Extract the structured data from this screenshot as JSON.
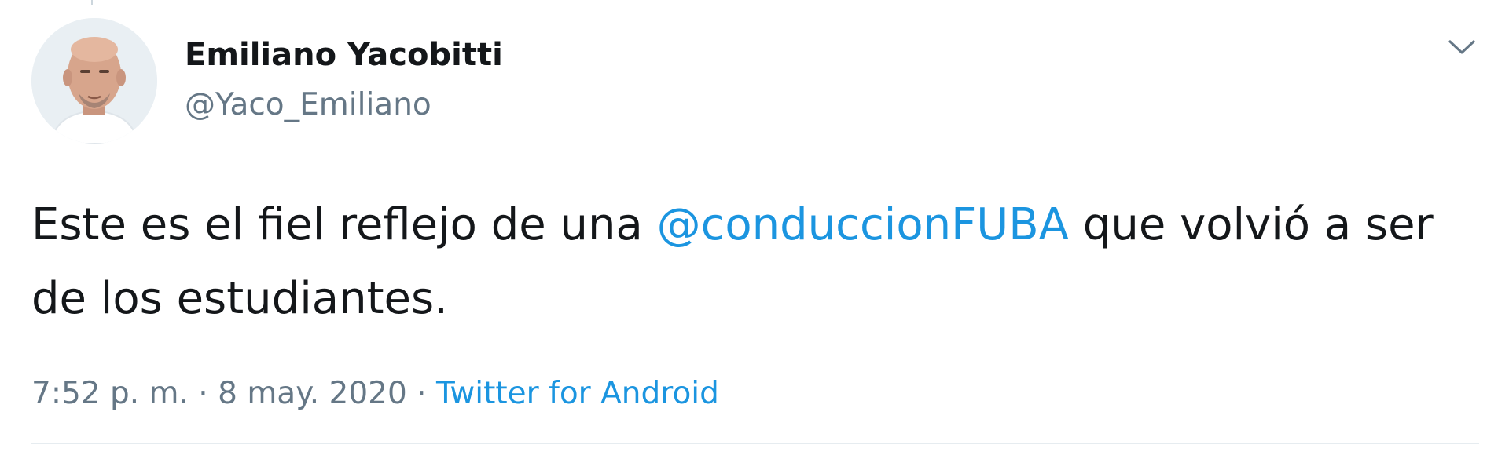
{
  "tweet": {
    "author_name": "Emiliano Yacobitti",
    "author_handle": "@Yaco_Emiliano",
    "text_before": "Este es el fiel reflejo de una ",
    "mention": "@conduccionFUBA",
    "text_after": " que volvió a ser de los estudiantes.",
    "timestamp": "7:52 p. m. · 8 may. 2020",
    "separator": " · ",
    "source": "Twitter for Android",
    "menu_icon": "chevron-down-icon",
    "avatar_icon": "profile-photo"
  },
  "colors": {
    "link": "#1b95e0",
    "text": "#14171a",
    "secondary": "#657786",
    "divider": "#e6ecf0"
  }
}
